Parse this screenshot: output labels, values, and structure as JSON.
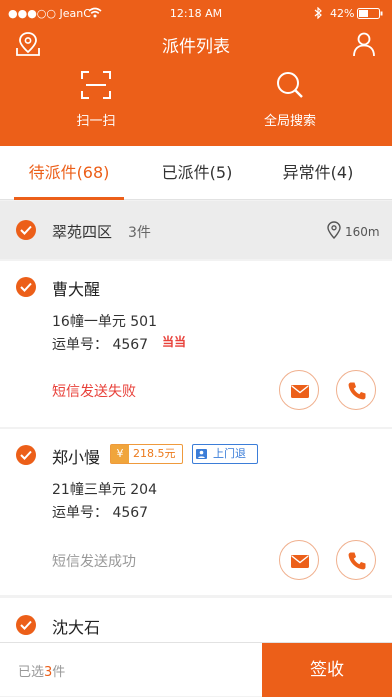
{
  "status_bar": {
    "carrier": "●●●○○ JeanC",
    "time": "12:18 AM",
    "battery": "42%"
  },
  "header": {
    "title": "派件列表",
    "scan_label": "扫一扫",
    "search_label": "全局搜索"
  },
  "tabs": [
    {
      "label": "待派件(68)"
    },
    {
      "label": "已派件(5)"
    },
    {
      "label": "异常件(4)"
    }
  ],
  "group": {
    "name": "翠苑四区",
    "count": "3件",
    "distance": "160m"
  },
  "items": [
    {
      "name": "曹大醒",
      "address": "16幢一单元 501",
      "waybill": "运单号： 4567",
      "badge": "当当",
      "sms": "短信发送失败"
    },
    {
      "name": "郑小慢",
      "address": "21幢三单元 204",
      "waybill": "运单号： 4567",
      "price_symbol": "¥",
      "price": "218.5元",
      "pickup": "上门退",
      "sms": "短信发送成功"
    },
    {
      "name": "沈大石"
    }
  ],
  "bottom": {
    "selected_prefix": "已选",
    "selected_count": "3",
    "selected_suffix": "件",
    "sign_label": "签收"
  },
  "colors": {
    "accent": "#ec5f19",
    "error": "#e8413a",
    "blue_tag": "#3b7dd8"
  }
}
